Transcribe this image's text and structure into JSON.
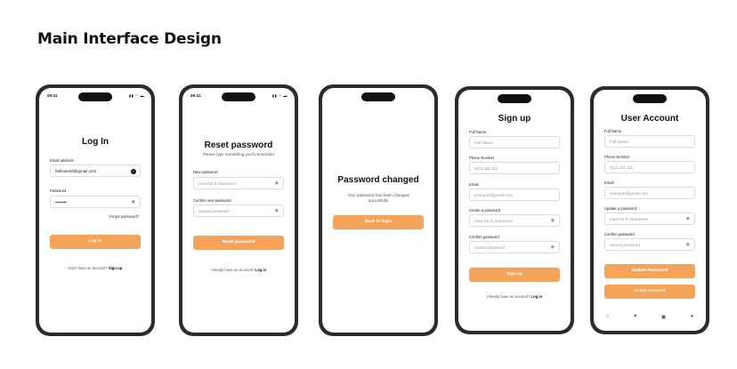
{
  "page_title": "Main Interface Design",
  "status": {
    "time": "09:41",
    "icons": "▮▮ ◠ ▬"
  },
  "login": {
    "title": "Log In",
    "email_label": "Email address",
    "email_value": "helloworld@gmail.com",
    "password_label": "Password",
    "password_value": "••••••••",
    "forgot": "Forgot password?",
    "button": "Log in",
    "footer_text": "Don't have an account?",
    "footer_link": "Sign up"
  },
  "reset": {
    "title": "Reset password",
    "subtitle": "Please type something you'll remember",
    "new_label": "New password",
    "new_placeholder": "must be 8 characters",
    "confirm_label": "Confirm new password",
    "confirm_placeholder": "repeat password",
    "button": "Reset password",
    "footer_text": "Already have an account?",
    "footer_link": "Log in"
  },
  "changed": {
    "title": "Password changed",
    "message": "Your password has been changed succesfully",
    "button": "Back to login"
  },
  "signup": {
    "title": "Sign up",
    "name_label": "Full Name",
    "name_placeholder": "Full Name",
    "phone_label": "Phone Number",
    "phone_placeholder": "0111 111 111",
    "email_label": "Email",
    "email_placeholder": "example@gmail.com",
    "pass_label": "Create a password",
    "pass_placeholder": "must be 8 characters",
    "confirm_label": "Confirm password",
    "confirm_placeholder": "repeat password",
    "button": "Sign up",
    "footer_text": "Already have an account?",
    "footer_link": "Log in"
  },
  "account": {
    "title": "User Account",
    "name_label": "Full Name",
    "name_placeholder": "Full Name",
    "phone_label": "Phone Number",
    "phone_placeholder": "0111 111 111",
    "email_label": "Email",
    "email_placeholder": "example@gmail.com",
    "pass_label": "Update a password",
    "pass_placeholder": "must be 8 characters",
    "confirm_label": "Confirm password",
    "confirm_placeholder": "repeat password",
    "update_button": "Update Password",
    "delete_button": "Delete Account",
    "tabs": [
      "⌂",
      "♥",
      "▣",
      "●"
    ]
  },
  "colors": {
    "accent": "#f4a45a"
  }
}
